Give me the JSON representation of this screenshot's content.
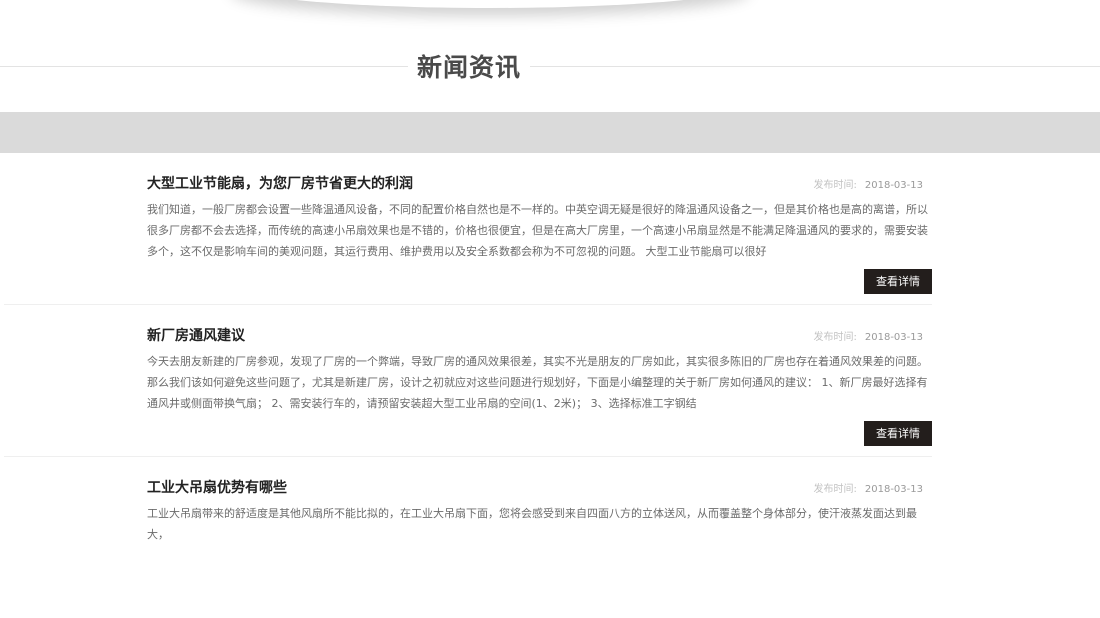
{
  "section": {
    "title": "新闻资讯"
  },
  "news": [
    {
      "title": "大型工业节能扇，为您厂房节省更大的利润",
      "date_label": "发布时间:",
      "date": "2018-03-13",
      "summary": "我们知道，一般厂房都会设置一些降温通风设备，不同的配置价格自然也是不一样的。中英空调无疑是很好的降温通风设备之一，但是其价格也是高的离谱，所以很多厂房都不会去选择，而传统的高速小吊扇效果也是不错的，价格也很便宜，但是在高大厂房里，一个高速小吊扇显然是不能满足降温通风的要求的，需要安装多个，这不仅是影响车间的美观问题，其运行费用、维护费用以及安全系数都会称为不可忽视的问题。 大型工业节能扇可以很好",
      "button_label": "查看详情"
    },
    {
      "title": "新厂房通风建议",
      "date_label": "发布时间:",
      "date": "2018-03-13",
      "summary": "今天去朋友新建的厂房参观，发现了厂房的一个弊端，导致厂房的通风效果很差，其实不光是朋友的厂房如此，其实很多陈旧的厂房也存在着通风效果差的问题。那么我们该如何避免这些问题了，尤其是新建厂房，设计之初就应对这些问题进行规划好，下面是小编整理的关于新厂房如何通风的建议： 1、新厂房最好选择有通风井或侧面带换气扇； 2、需安装行车的，请预留安装超大型工业吊扇的空间(1、2米)； 3、选择标准工字钢结",
      "button_label": "查看详情"
    },
    {
      "title": "工业大吊扇优势有哪些",
      "date_label": "发布时间:",
      "date": "2018-03-13",
      "summary": "工业大吊扇带来的舒适度是其他风扇所不能比拟的，在工业大吊扇下面，您将会感受到来自四面八方的立体送风，从而覆盖整个身体部分，使汗液蒸发面达到最大，"
    }
  ]
}
